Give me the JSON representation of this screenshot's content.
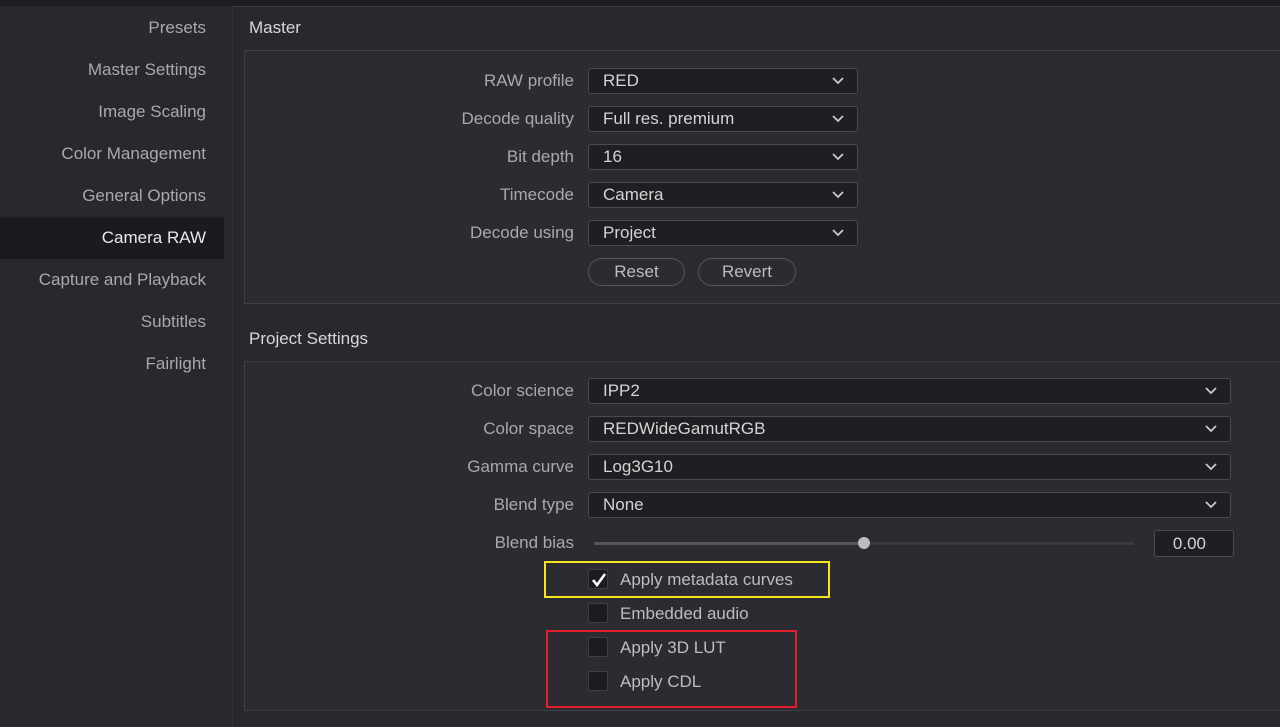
{
  "sidebar": {
    "items": [
      {
        "label": "Presets"
      },
      {
        "label": "Master Settings"
      },
      {
        "label": "Image Scaling"
      },
      {
        "label": "Color Management"
      },
      {
        "label": "General Options"
      },
      {
        "label": "Camera RAW",
        "active": true
      },
      {
        "label": "Capture and Playback"
      },
      {
        "label": "Subtitles"
      },
      {
        "label": "Fairlight"
      }
    ]
  },
  "master": {
    "title": "Master",
    "raw_profile": {
      "label": "RAW profile",
      "value": "RED"
    },
    "decode_quality": {
      "label": "Decode quality",
      "value": "Full res. premium"
    },
    "bit_depth": {
      "label": "Bit depth",
      "value": "16"
    },
    "timecode": {
      "label": "Timecode",
      "value": "Camera"
    },
    "decode_using": {
      "label": "Decode using",
      "value": "Project"
    },
    "reset_label": "Reset",
    "revert_label": "Revert"
  },
  "project": {
    "title": "Project Settings",
    "color_science": {
      "label": "Color science",
      "value": "IPP2"
    },
    "color_space": {
      "label": "Color space",
      "value": "REDWideGamutRGB"
    },
    "gamma_curve": {
      "label": "Gamma curve",
      "value": "Log3G10"
    },
    "blend_type": {
      "label": "Blend type",
      "value": "None"
    },
    "blend_bias": {
      "label": "Blend bias",
      "value": "0.00",
      "slider_fraction": 0.5
    },
    "checkboxes": {
      "apply_metadata_curves": {
        "label": "Apply metadata curves",
        "checked": true
      },
      "embedded_audio": {
        "label": "Embedded audio",
        "checked": false
      },
      "apply_3d_lut": {
        "label": "Apply 3D LUT",
        "checked": false
      },
      "apply_cdl": {
        "label": "Apply CDL",
        "checked": false
      }
    }
  },
  "annotations": {
    "highlight_yellow": "#f3e61c",
    "highlight_red": "#e31e2a"
  },
  "icons": {
    "dropdown": "chevron-down-icon",
    "checkbox_checked": "checkmark-icon"
  }
}
